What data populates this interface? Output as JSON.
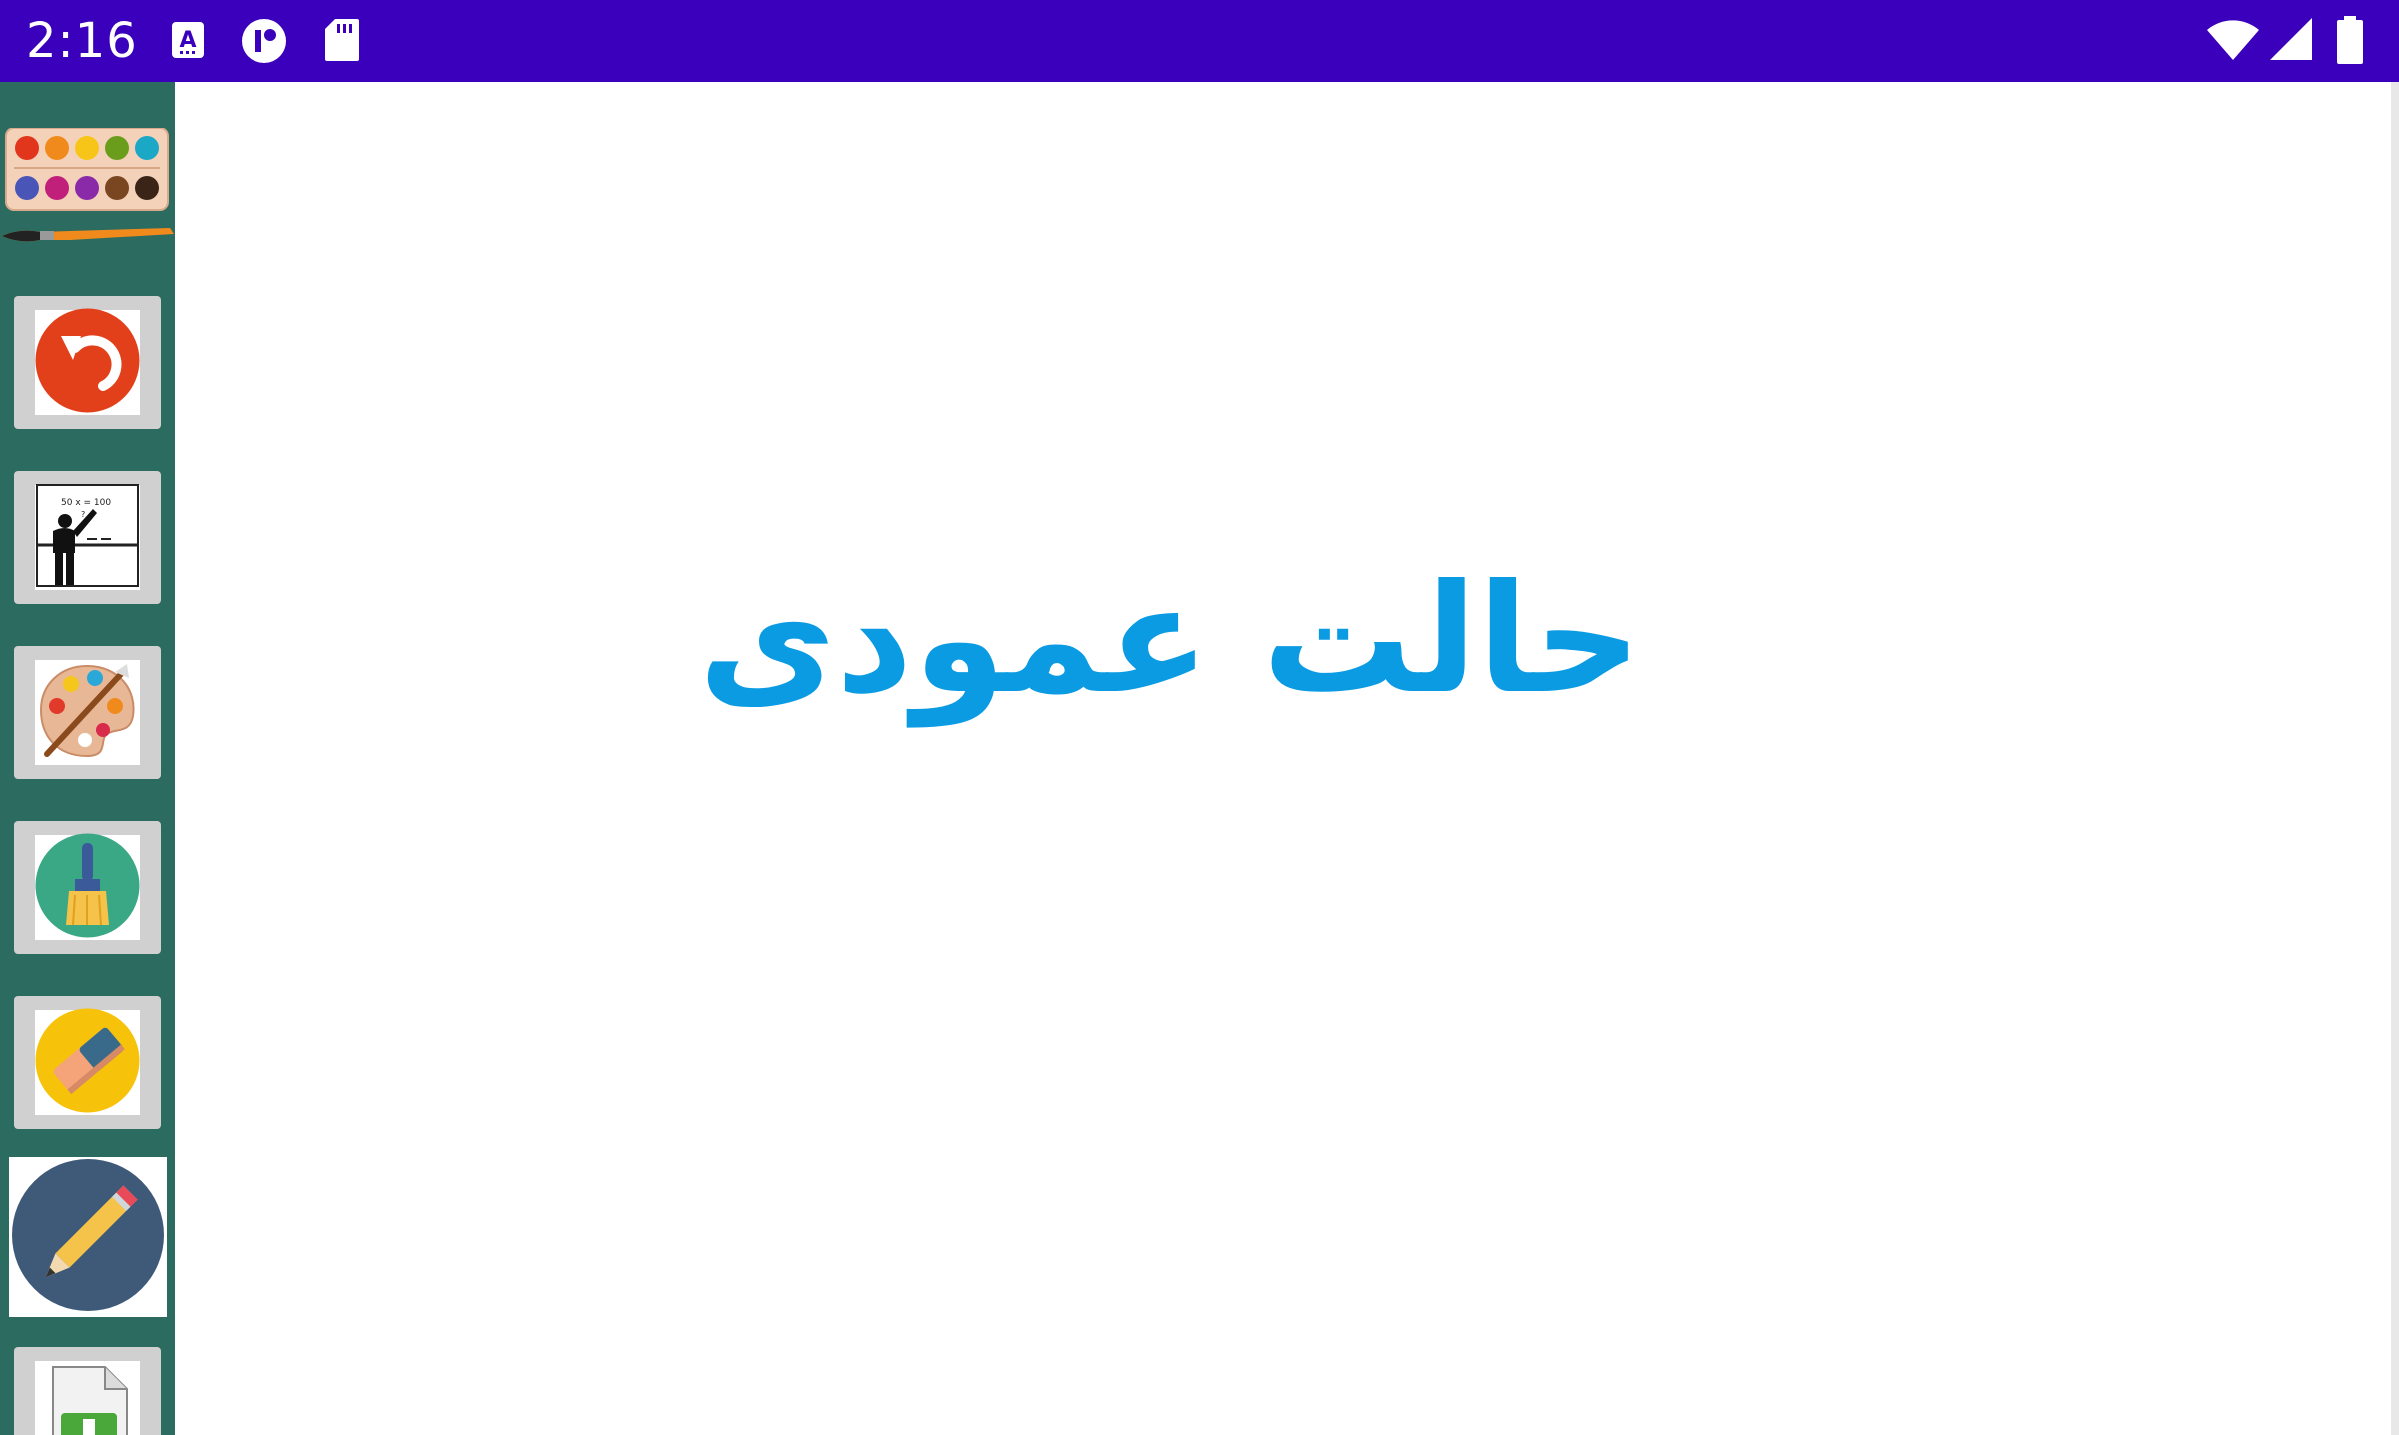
{
  "status_bar": {
    "time": "2:16",
    "background": "#3a00bb",
    "left_icons": [
      "keyboard-a-icon",
      "app-circle-icon",
      "sd-card-icon"
    ],
    "right_icons": [
      "wifi-icon",
      "cellular-signal-icon",
      "battery-icon"
    ]
  },
  "sidebar": {
    "background": "#2c6b5f",
    "tools": [
      {
        "name": "color-palette-brush-tool",
        "icon": "paint-tray-brush-icon"
      },
      {
        "name": "undo-tool",
        "icon": "undo-icon"
      },
      {
        "name": "teacher-board-tool",
        "icon": "teacher-board-icon"
      },
      {
        "name": "artist-palette-tool",
        "icon": "artist-palette-icon"
      },
      {
        "name": "paint-brush-tool",
        "icon": "paint-brush-icon"
      },
      {
        "name": "eraser-tool",
        "icon": "eraser-icon"
      },
      {
        "name": "pencil-tool",
        "icon": "pencil-icon",
        "active": true
      },
      {
        "name": "new-page-tool",
        "icon": "add-file-icon"
      }
    ]
  },
  "canvas": {
    "message": "حالت عمودی",
    "message_color": "#0b9be3"
  }
}
